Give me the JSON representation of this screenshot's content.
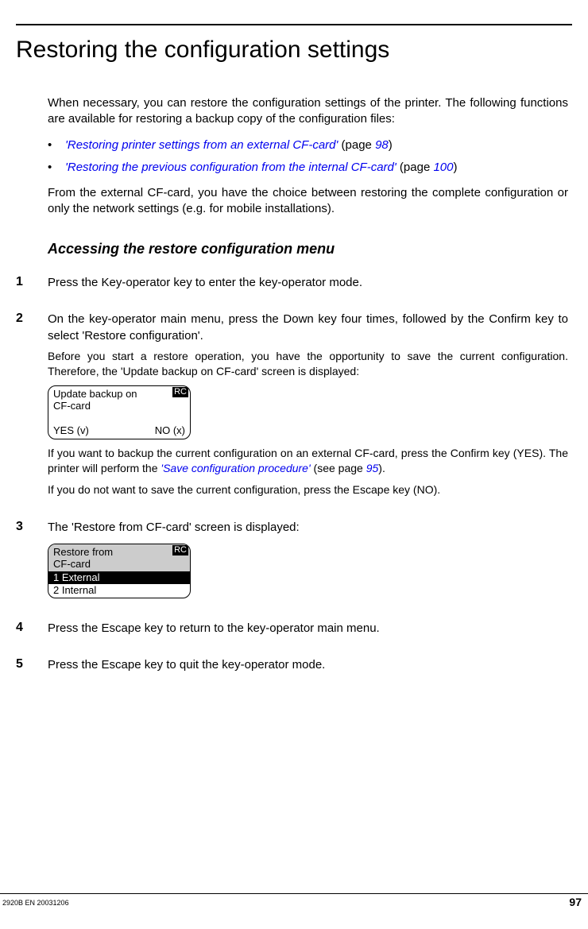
{
  "title": "Restoring the configuration settings",
  "intro": "When necessary, you can restore the configuration settings of the printer. The following functions are available for restoring a backup copy of the configuration files:",
  "bullets": [
    {
      "link": "'Restoring printer settings from an external CF-card'",
      "suffix": " (page ",
      "page": "98",
      "close": ")"
    },
    {
      "link": "'Restoring the previous configuration from the internal CF-card'",
      "suffix": " (page ",
      "page": "100",
      "close": ")"
    }
  ],
  "after_bullets": "From the external CF-card, you have the choice between restoring the complete configuration or only the network settings (e.g. for mobile installations).",
  "subhead": "Accessing the restore configuration menu",
  "steps": {
    "s1": {
      "num": "1",
      "main": "Press the Key-operator key to enter the key-operator mode."
    },
    "s2": {
      "num": "2",
      "main": "On the key-operator main menu, press the Down key four times, followed by the Confirm key to select 'Restore configuration'.",
      "sub1": "Before you start a restore operation, you have the opportunity to save the current configuration. Therefore, the 'Update backup on CF-card' screen is displayed:",
      "lcd": {
        "badge": "RC",
        "line1": "Update backup on",
        "line2": "CF-card",
        "yes": "YES (v)",
        "no": "NO (x)"
      },
      "sub2a": "If you want to backup the current configuration on an external CF-card, press the Confirm key (YES). The printer will perform the ",
      "sub2link": "'Save configuration procedure'",
      "sub2b": " (see page ",
      "sub2page": "95",
      "sub2c": ").",
      "sub3": "If you do not want to save the current configuration, press the Escape key (NO)."
    },
    "s3": {
      "num": "3",
      "main": "The 'Restore from CF-card' screen is displayed:",
      "lcd": {
        "badge": "RC",
        "h1": "Restore from",
        "h2": "CF-card",
        "opt1": "1 External",
        "opt2": "2 Internal"
      }
    },
    "s4": {
      "num": "4",
      "main": "Press the Escape key to return to the key-operator main menu."
    },
    "s5": {
      "num": "5",
      "main": "Press the Escape key to quit the key-operator mode."
    }
  },
  "footer": {
    "left": "2920B EN 20031206",
    "right": "97"
  }
}
